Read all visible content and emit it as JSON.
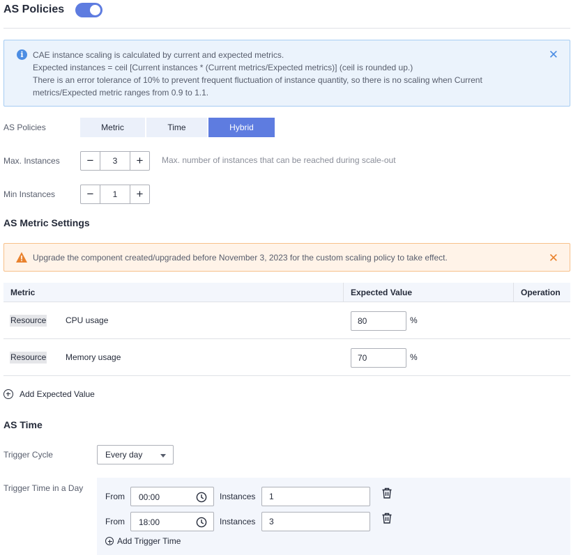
{
  "header": {
    "title": "AS Policies",
    "toggle_on": true
  },
  "info_alert": {
    "lines": [
      "CAE instance scaling is calculated by current and expected metrics.",
      "Expected instances = ceil [Current instances * (Current metrics/Expected metrics)] (ceil is rounded up.)",
      "There is an error tolerance of 10% to prevent frequent fluctuation of instance quantity, so there is no scaling when Current",
      "metrics/Expected metric ranges from 0.9 to 1.1."
    ],
    "close_icon": "close-icon"
  },
  "policy": {
    "label": "AS Policies",
    "options": [
      "Metric",
      "Time",
      "Hybrid"
    ],
    "selected": "Hybrid"
  },
  "max_instances": {
    "label": "Max. Instances",
    "value": "3",
    "hint": "Max. number of instances that can be reached during scale-out"
  },
  "min_instances": {
    "label": "Min Instances",
    "value": "1"
  },
  "metric_settings": {
    "title": "AS Metric Settings",
    "warning": "Upgrade the component created/upgraded before November 3, 2023 for the custom scaling policy to take effect.",
    "columns": [
      "Metric",
      "Expected Value",
      "Operation"
    ],
    "rows": [
      {
        "tag": "Resource",
        "name": "CPU usage",
        "value": "80",
        "unit": "%"
      },
      {
        "tag": "Resource",
        "name": "Memory usage",
        "value": "70",
        "unit": "%"
      }
    ],
    "add_label": "Add Expected Value"
  },
  "as_time": {
    "title": "AS Time",
    "cycle_label": "Trigger Cycle",
    "cycle_value": "Every day",
    "time_label": "Trigger Time in a Day",
    "from_label": "From",
    "instances_label": "Instances",
    "triggers": [
      {
        "time": "00:00",
        "instances": "1"
      },
      {
        "time": "18:00",
        "instances": "3"
      }
    ],
    "add_label": "Add Trigger Time"
  },
  "colors": {
    "accent": "#5e7ce0",
    "info_bg": "#ebf3fc",
    "warn_bg": "#fff3e8",
    "warn_icon": "#e9822e"
  }
}
